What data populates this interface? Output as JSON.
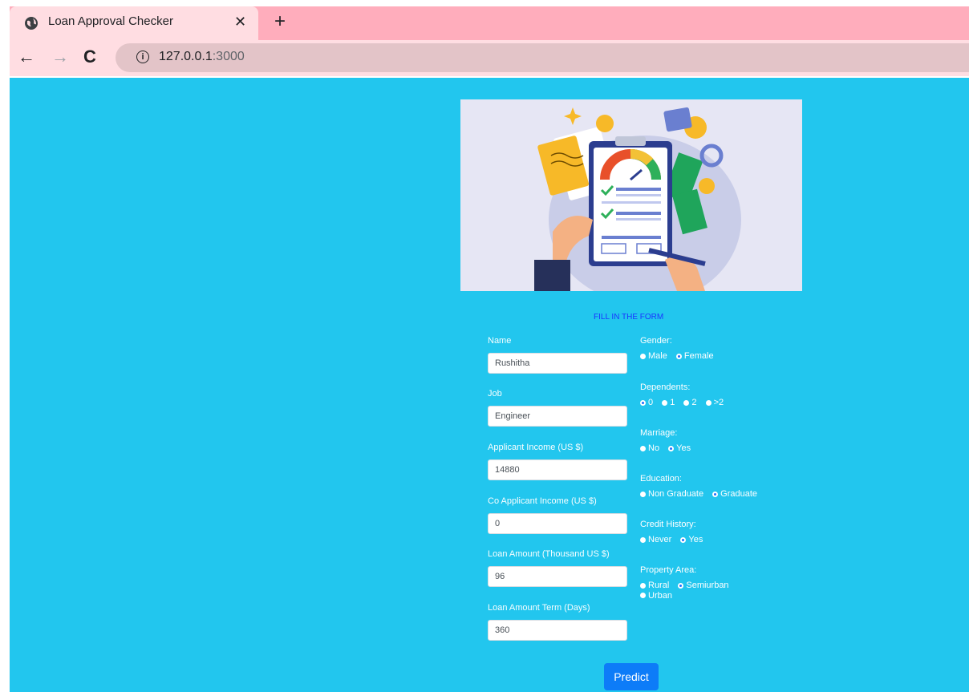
{
  "browser": {
    "tab_title": "Loan Approval Checker",
    "tab_close": "✕",
    "new_tab": "+",
    "url_host": "127.0.0.1",
    "url_port": ":3000"
  },
  "form": {
    "title": "FILL IN THE FORM",
    "fields": [
      {
        "label": "Name",
        "value": "Rushitha"
      },
      {
        "label": "Job",
        "value": "Engineer"
      },
      {
        "label": "Applicant Income (US $)",
        "value": "14880"
      },
      {
        "label": "Co Applicant Income (US $)",
        "value": "0"
      },
      {
        "label": "Loan Amount (Thousand US $)",
        "value": "96"
      },
      {
        "label": "Loan Amount Term (Days)",
        "value": "360"
      }
    ],
    "gender": {
      "label": "Gender:",
      "options": [
        "Male",
        "Female"
      ],
      "selected": "Female"
    },
    "dependents": {
      "label": "Dependents:",
      "options": [
        "0",
        "1",
        "2",
        ">2"
      ],
      "selected": "0"
    },
    "marriage": {
      "label": "Marriage:",
      "options": [
        "No",
        "Yes"
      ],
      "selected": "Yes"
    },
    "education": {
      "label": "Education:",
      "options": [
        "Non Graduate",
        "Graduate"
      ],
      "selected": "Graduate"
    },
    "credit_history": {
      "label": "Credit History:",
      "options": [
        "Never",
        "Yes"
      ],
      "selected": "Yes"
    },
    "property_area": {
      "label": "Property Area:",
      "options": [
        "Rural",
        "Semiurban",
        "Urban"
      ],
      "selected": "Semiurban"
    },
    "predict_label": "Predict"
  },
  "colors": {
    "page_bg": "#22c6ee",
    "button": "#0d7cf8",
    "title": "#1a35ff"
  },
  "illustration": {
    "icon": "loan-checklist-illustration"
  }
}
